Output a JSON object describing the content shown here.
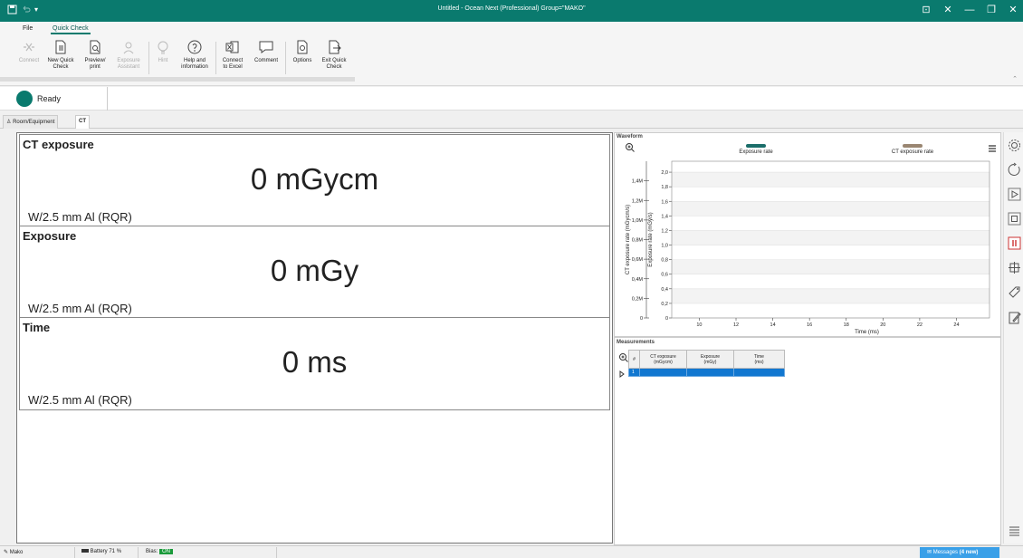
{
  "titlebar": {
    "title": "Untitled - Ocean Next (Professional)   Group=\"MAKO\"",
    "controls": [
      "⊡",
      "✕",
      "—",
      "❐",
      "✕"
    ]
  },
  "menu": {
    "file": "File",
    "quick_check": "Quick Check"
  },
  "ribbon": {
    "connect": "Connect",
    "new_quick_check": [
      "New Quick",
      "Check"
    ],
    "preview_print": [
      "Preview/",
      "print"
    ],
    "exposure_assistant": [
      "Exposure",
      "Assistant"
    ],
    "hint": "Hint",
    "help_info": [
      "Help and",
      "information"
    ],
    "connect_excel": [
      "Connect",
      "to Excel"
    ],
    "comment": "Comment",
    "options": "Options",
    "exit_quick_check": [
      "Exit Quick",
      "Check"
    ]
  },
  "status": {
    "text": "Ready"
  },
  "doc_tabs": {
    "room": "Room/Equipment",
    "ct": "CT"
  },
  "measurements_display": [
    {
      "title": "CT exposure",
      "value": "0",
      "unit": "mGycm",
      "filter": "W/2.5 mm Al (RQR)"
    },
    {
      "title": "Exposure",
      "value": "0",
      "unit": "mGy",
      "filter": "W/2.5 mm Al (RQR)"
    },
    {
      "title": "Time",
      "value": "0",
      "unit": "ms",
      "filter": "W/2.5 mm Al (RQR)"
    }
  ],
  "waveform": {
    "title": "Waveform",
    "legend": [
      {
        "label": "Exposure rate",
        "color": "#1b6e6a"
      },
      {
        "label": "CT exposure rate",
        "color": "#9a8672"
      }
    ]
  },
  "chart_data": {
    "type": "line",
    "series": [
      {
        "name": "Exposure rate",
        "values": []
      },
      {
        "name": "CT exposure rate",
        "values": []
      }
    ],
    "xlabel": "Time (ms)",
    "ylabel_left": "CT exposure rate (mGycm/s)",
    "ylabel_right": "Exposure rate (mGy/s)",
    "xticks": [
      "10",
      "12",
      "14",
      "16",
      "18",
      "20",
      "22",
      "24"
    ],
    "xlim": [
      8.5,
      25.8
    ],
    "y1ticks": [
      "0",
      "0,2M",
      "0,4M",
      "0,6M",
      "0,8M",
      "1,0M",
      "1,2M",
      "1,4M"
    ],
    "y1lim": [
      0,
      1.6
    ],
    "y2ticks": [
      "0",
      "0,2",
      "0,4",
      "0,6",
      "0,8",
      "1,0",
      "1,2",
      "1,4",
      "1,6",
      "1,8",
      "2,0"
    ],
    "y2lim": [
      0,
      2.15
    ],
    "grid": true
  },
  "measurements_table": {
    "title": "Measurements",
    "columns": [
      "#",
      "CT exposure\n(mGycm)",
      "Exposure\n(mGy)",
      "Time\n(ms)"
    ],
    "rows": [
      [
        "1",
        "",
        "",
        ""
      ]
    ]
  },
  "statusbar": {
    "user": "Mako",
    "battery": "Battery 71 %",
    "bias_label": "Bias:",
    "bias_state": "ON",
    "messages": "Messages",
    "messages_new": "(4 new)"
  }
}
